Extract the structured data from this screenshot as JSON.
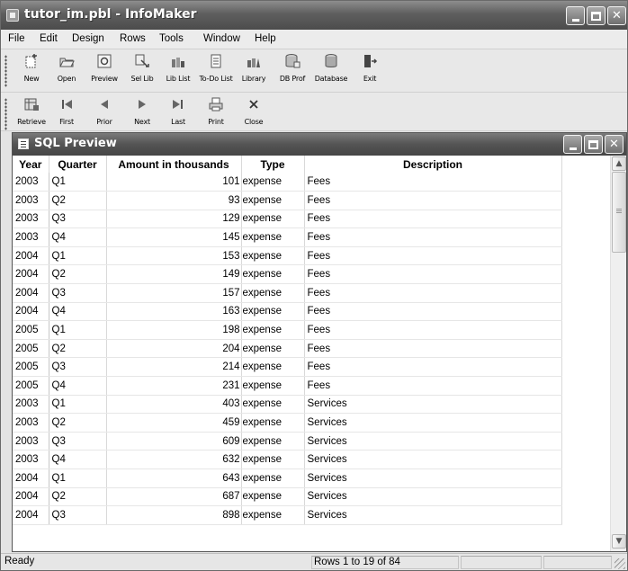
{
  "window": {
    "title": "tutor_im.pbl - InfoMaker",
    "buttons": {
      "minimize": "_",
      "maximize": "□",
      "close": "✕"
    }
  },
  "menu": [
    "File",
    "Edit",
    "Design",
    "Rows",
    "Tools",
    "Window",
    "Help"
  ],
  "toolbar1": [
    {
      "label": "New",
      "icon": "new-file-icon"
    },
    {
      "label": "Open",
      "icon": "open-folder-icon"
    },
    {
      "label": "Preview",
      "icon": "preview-icon"
    },
    {
      "label": "Sel Lib",
      "icon": "select-library-icon"
    },
    {
      "label": "Lib List",
      "icon": "library-list-icon"
    },
    {
      "label": "To-Do List",
      "icon": "todo-list-icon"
    },
    {
      "label": "Library",
      "icon": "library-icon"
    },
    {
      "label": "DB Prof",
      "icon": "db-profile-icon"
    },
    {
      "label": "Database",
      "icon": "database-icon"
    },
    {
      "label": "Exit",
      "icon": "exit-icon"
    }
  ],
  "toolbar2": [
    {
      "label": "Retrieve",
      "icon": "retrieve-icon"
    },
    {
      "label": "First",
      "icon": "first-icon"
    },
    {
      "label": "Prior",
      "icon": "prior-icon"
    },
    {
      "label": "Next",
      "icon": "next-icon"
    },
    {
      "label": "Last",
      "icon": "last-icon"
    },
    {
      "label": "Print",
      "icon": "print-icon"
    },
    {
      "label": "Close",
      "icon": "close-icon"
    }
  ],
  "child": {
    "title": "SQL Preview",
    "columns": [
      "Year",
      "Quarter",
      "Amount in thousands",
      "Type",
      "Description"
    ],
    "rows": [
      [
        "2003",
        "Q1",
        "101",
        "expense",
        "Fees"
      ],
      [
        "2003",
        "Q2",
        "93",
        "expense",
        "Fees"
      ],
      [
        "2003",
        "Q3",
        "129",
        "expense",
        "Fees"
      ],
      [
        "2003",
        "Q4",
        "145",
        "expense",
        "Fees"
      ],
      [
        "2004",
        "Q1",
        "153",
        "expense",
        "Fees"
      ],
      [
        "2004",
        "Q2",
        "149",
        "expense",
        "Fees"
      ],
      [
        "2004",
        "Q3",
        "157",
        "expense",
        "Fees"
      ],
      [
        "2004",
        "Q4",
        "163",
        "expense",
        "Fees"
      ],
      [
        "2005",
        "Q1",
        "198",
        "expense",
        "Fees"
      ],
      [
        "2005",
        "Q2",
        "204",
        "expense",
        "Fees"
      ],
      [
        "2005",
        "Q3",
        "214",
        "expense",
        "Fees"
      ],
      [
        "2005",
        "Q4",
        "231",
        "expense",
        "Fees"
      ],
      [
        "2003",
        "Q1",
        "403",
        "expense",
        "Services"
      ],
      [
        "2003",
        "Q2",
        "459",
        "expense",
        "Services"
      ],
      [
        "2003",
        "Q3",
        "609",
        "expense",
        "Services"
      ],
      [
        "2003",
        "Q4",
        "632",
        "expense",
        "Services"
      ],
      [
        "2004",
        "Q1",
        "643",
        "expense",
        "Services"
      ],
      [
        "2004",
        "Q2",
        "687",
        "expense",
        "Services"
      ],
      [
        "2004",
        "Q3",
        "898",
        "expense",
        "Services"
      ]
    ]
  },
  "status": {
    "left": "Ready",
    "rows": "Rows 1 to 19 of 84"
  }
}
